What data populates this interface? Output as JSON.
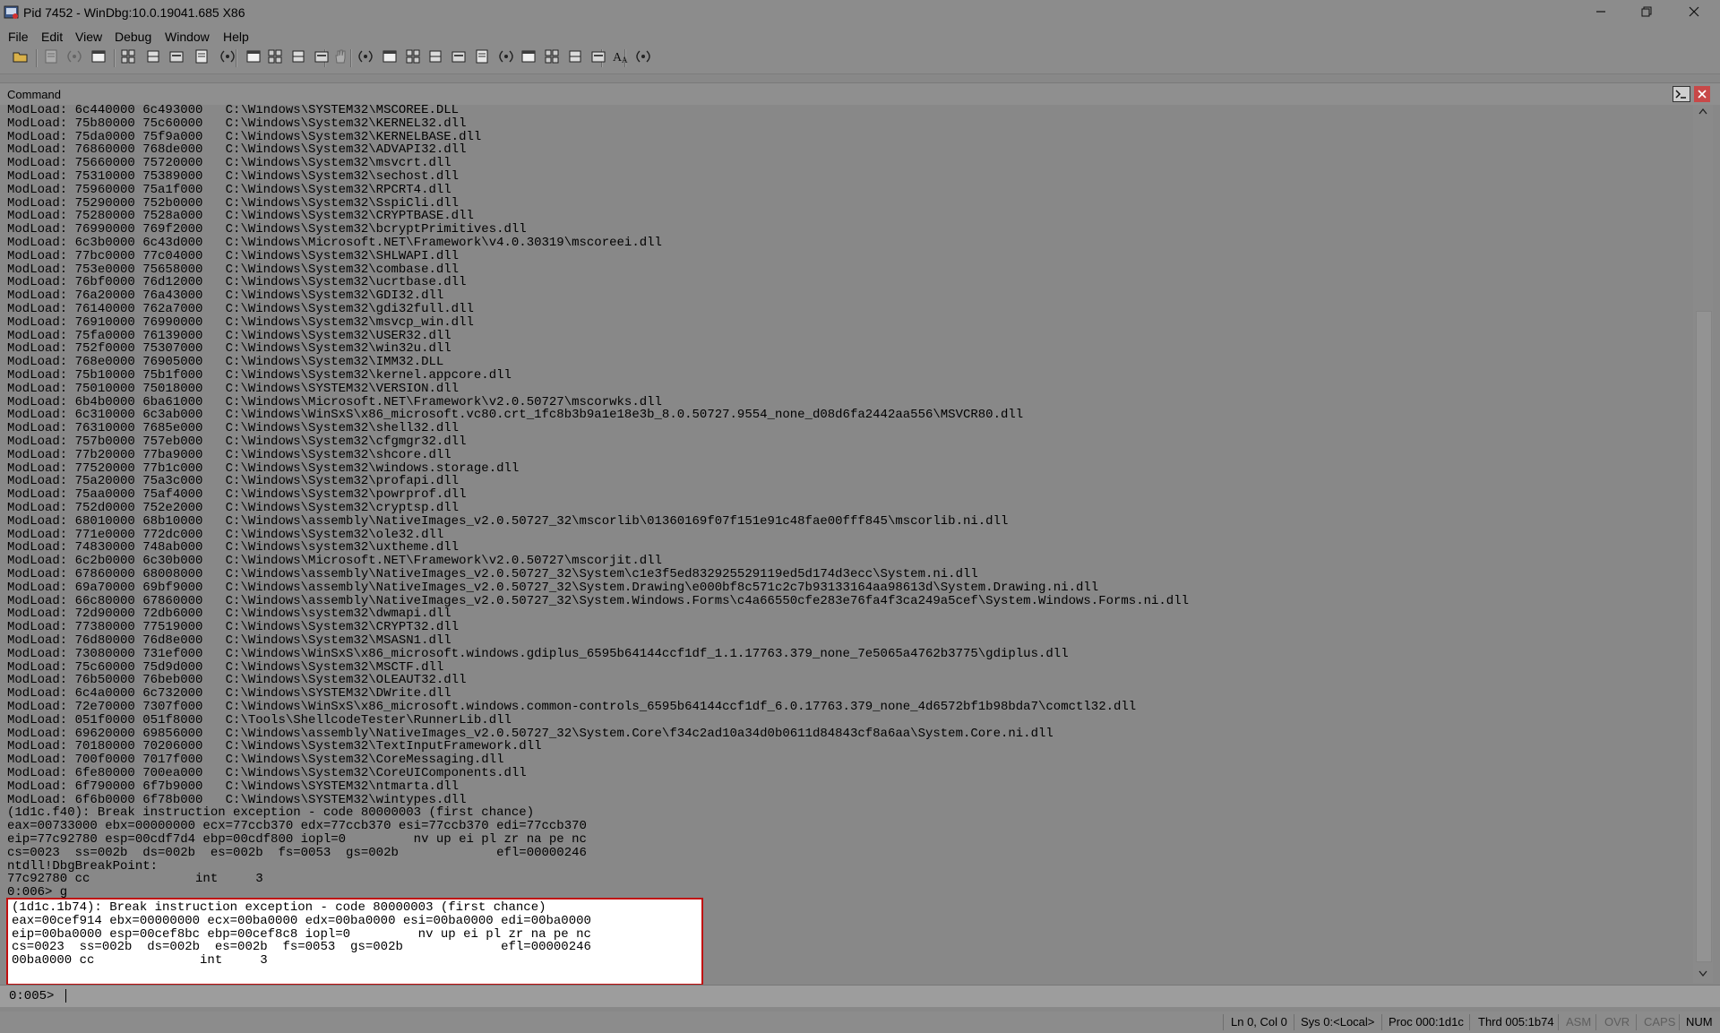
{
  "window": {
    "title": "Pid 7452 - WinDbg:10.0.19041.685 X86"
  },
  "menu": [
    "File",
    "Edit",
    "View",
    "Debug",
    "Window",
    "Help"
  ],
  "toolbar": {
    "icons": [
      "open-folder-icon",
      "cut-icon",
      "copy-icon",
      "paste-icon",
      "go-icon",
      "restart-icon",
      "stop-debugging-icon",
      "detach-icon",
      "break-icon",
      "step-into-icon",
      "step-over-icon",
      "step-out-icon",
      "run-to-cursor-icon",
      "hand-icon",
      "command-window-icon",
      "watch-window-icon",
      "locals-window-icon",
      "registers-window-icon",
      "memory-window-icon",
      "call-stack-window-icon",
      "disassembly-window-icon",
      "scratch-pad-icon",
      "processes-threads-icon",
      "source-mode-icon",
      "hex-mode-icon",
      "font-icon",
      "options-icon"
    ]
  },
  "panel": {
    "title": "Command"
  },
  "log_lines": [
    "ModLoad: 6c440000 6c493000   C:\\Windows\\SYSTEM32\\MSCOREE.DLL",
    "ModLoad: 75b80000 75c60000   C:\\Windows\\System32\\KERNEL32.dll",
    "ModLoad: 75da0000 75f9a000   C:\\Windows\\System32\\KERNELBASE.dll",
    "ModLoad: 76860000 768de000   C:\\Windows\\System32\\ADVAPI32.dll",
    "ModLoad: 75660000 75720000   C:\\Windows\\System32\\msvcrt.dll",
    "ModLoad: 75310000 75389000   C:\\Windows\\System32\\sechost.dll",
    "ModLoad: 75960000 75a1f000   C:\\Windows\\System32\\RPCRT4.dll",
    "ModLoad: 75290000 752b0000   C:\\Windows\\System32\\SspiCli.dll",
    "ModLoad: 75280000 7528a000   C:\\Windows\\System32\\CRYPTBASE.dll",
    "ModLoad: 76990000 769f2000   C:\\Windows\\System32\\bcryptPrimitives.dll",
    "ModLoad: 6c3b0000 6c43d000   C:\\Windows\\Microsoft.NET\\Framework\\v4.0.30319\\mscoreei.dll",
    "ModLoad: 77bc0000 77c04000   C:\\Windows\\System32\\SHLWAPI.dll",
    "ModLoad: 753e0000 75658000   C:\\Windows\\System32\\combase.dll",
    "ModLoad: 76bf0000 76d12000   C:\\Windows\\System32\\ucrtbase.dll",
    "ModLoad: 76a20000 76a43000   C:\\Windows\\System32\\GDI32.dll",
    "ModLoad: 76140000 762a7000   C:\\Windows\\System32\\gdi32full.dll",
    "ModLoad: 76910000 76990000   C:\\Windows\\System32\\msvcp_win.dll",
    "ModLoad: 75fa0000 76139000   C:\\Windows\\System32\\USER32.dll",
    "ModLoad: 752f0000 75307000   C:\\Windows\\System32\\win32u.dll",
    "ModLoad: 768e0000 76905000   C:\\Windows\\System32\\IMM32.DLL",
    "ModLoad: 75b10000 75b1f000   C:\\Windows\\System32\\kernel.appcore.dll",
    "ModLoad: 75010000 75018000   C:\\Windows\\SYSTEM32\\VERSION.dll",
    "ModLoad: 6b4b0000 6ba61000   C:\\Windows\\Microsoft.NET\\Framework\\v2.0.50727\\mscorwks.dll",
    "ModLoad: 6c310000 6c3ab000   C:\\Windows\\WinSxS\\x86_microsoft.vc80.crt_1fc8b3b9a1e18e3b_8.0.50727.9554_none_d08d6fa2442aa556\\MSVCR80.dll",
    "ModLoad: 76310000 7685e000   C:\\Windows\\System32\\shell32.dll",
    "ModLoad: 757b0000 757eb000   C:\\Windows\\System32\\cfgmgr32.dll",
    "ModLoad: 77b20000 77ba9000   C:\\Windows\\System32\\shcore.dll",
    "ModLoad: 77520000 77b1c000   C:\\Windows\\System32\\windows.storage.dll",
    "ModLoad: 75a20000 75a3c000   C:\\Windows\\System32\\profapi.dll",
    "ModLoad: 75aa0000 75af4000   C:\\Windows\\System32\\powrprof.dll",
    "ModLoad: 752d0000 752e2000   C:\\Windows\\System32\\cryptsp.dll",
    "ModLoad: 68010000 68b10000   C:\\Windows\\assembly\\NativeImages_v2.0.50727_32\\mscorlib\\01360169f07f151e91c48fae00fff845\\mscorlib.ni.dll",
    "ModLoad: 771e0000 772dc000   C:\\Windows\\System32\\ole32.dll",
    "ModLoad: 74830000 748ab000   C:\\Windows\\system32\\uxtheme.dll",
    "ModLoad: 6c2b0000 6c30b000   C:\\Windows\\Microsoft.NET\\Framework\\v2.0.50727\\mscorjit.dll",
    "ModLoad: 67860000 68008000   C:\\Windows\\assembly\\NativeImages_v2.0.50727_32\\System\\c1e3f5ed832925529119ed5d174d3ecc\\System.ni.dll",
    "ModLoad: 69a70000 69bf9000   C:\\Windows\\assembly\\NativeImages_v2.0.50727_32\\System.Drawing\\e000bf8c571c2c7b93133164aa98613d\\System.Drawing.ni.dll",
    "ModLoad: 66c80000 67860000   C:\\Windows\\assembly\\NativeImages_v2.0.50727_32\\System.Windows.Forms\\c4a66550cfe283e76fa4f3ca249a5cef\\System.Windows.Forms.ni.dll",
    "ModLoad: 72d90000 72db6000   C:\\Windows\\system32\\dwmapi.dll",
    "ModLoad: 77380000 77519000   C:\\Windows\\System32\\CRYPT32.dll",
    "ModLoad: 76d80000 76d8e000   C:\\Windows\\System32\\MSASN1.dll",
    "ModLoad: 73080000 731ef000   C:\\Windows\\WinSxS\\x86_microsoft.windows.gdiplus_6595b64144ccf1df_1.1.17763.379_none_7e5065a4762b3775\\gdiplus.dll",
    "ModLoad: 75c60000 75d9d000   C:\\Windows\\System32\\MSCTF.dll",
    "ModLoad: 76b50000 76beb000   C:\\Windows\\System32\\OLEAUT32.dll",
    "ModLoad: 6c4a0000 6c732000   C:\\Windows\\SYSTEM32\\DWrite.dll",
    "ModLoad: 72e70000 7307f000   C:\\Windows\\WinSxS\\x86_microsoft.windows.common-controls_6595b64144ccf1df_6.0.17763.379_none_4d6572bf1b98bda7\\comctl32.dll",
    "ModLoad: 051f0000 051f8000   C:\\Tools\\ShellcodeTester\\RunnerLib.dll",
    "ModLoad: 69620000 69856000   C:\\Windows\\assembly\\NativeImages_v2.0.50727_32\\System.Core\\f34c2ad10a34d0b0611d84843cf8a6aa\\System.Core.ni.dll",
    "ModLoad: 70180000 70206000   C:\\Windows\\System32\\TextInputFramework.dll",
    "ModLoad: 700f0000 7017f000   C:\\Windows\\System32\\CoreMessaging.dll",
    "ModLoad: 6fe80000 700ea000   C:\\Windows\\System32\\CoreUIComponents.dll",
    "ModLoad: 6f790000 6f7b9000   C:\\Windows\\SYSTEM32\\ntmarta.dll",
    "ModLoad: 6f6b0000 6f78b000   C:\\Windows\\SYSTEM32\\wintypes.dll",
    "(1d1c.f40): Break instruction exception - code 80000003 (first chance)",
    "eax=00733000 ebx=00000000 ecx=77ccb370 edx=77ccb370 esi=77ccb370 edi=77ccb370",
    "eip=77c92780 esp=00cdf7d4 ebp=00cdf800 iopl=0         nv up ei pl zr na pe nc",
    "cs=0023  ss=002b  ds=002b  es=002b  fs=0053  gs=002b             efl=00000246",
    "ntdll!DbgBreakPoint:",
    "77c92780 cc              int     3",
    "0:006> g"
  ],
  "highlight_lines": [
    "(1d1c.1b74): Break instruction exception - code 80000003 (first chance)",
    "eax=00cef914 ebx=00000000 ecx=00ba0000 edx=00ba0000 esi=00ba0000 edi=00ba0000",
    "eip=00ba0000 esp=00cef8bc ebp=00cef8c8 iopl=0         nv up ei pl zr na pe nc",
    "cs=0023  ss=002b  ds=002b  es=002b  fs=0053  gs=002b             efl=00000246",
    "00ba0000 cc              int     3"
  ],
  "input": {
    "prompt": "0:005>",
    "value": ""
  },
  "status": [
    {
      "label": "Ln 0, Col 0",
      "active": true
    },
    {
      "label": "Sys 0:<Local>",
      "active": true
    },
    {
      "label": "Proc 000:1d1c",
      "active": true
    },
    {
      "label": "Thrd 005:1b74",
      "active": true
    },
    {
      "label": "ASM",
      "active": false
    },
    {
      "label": "OVR",
      "active": false
    },
    {
      "label": "CAPS",
      "active": false
    },
    {
      "label": "NUM",
      "active": true
    }
  ]
}
